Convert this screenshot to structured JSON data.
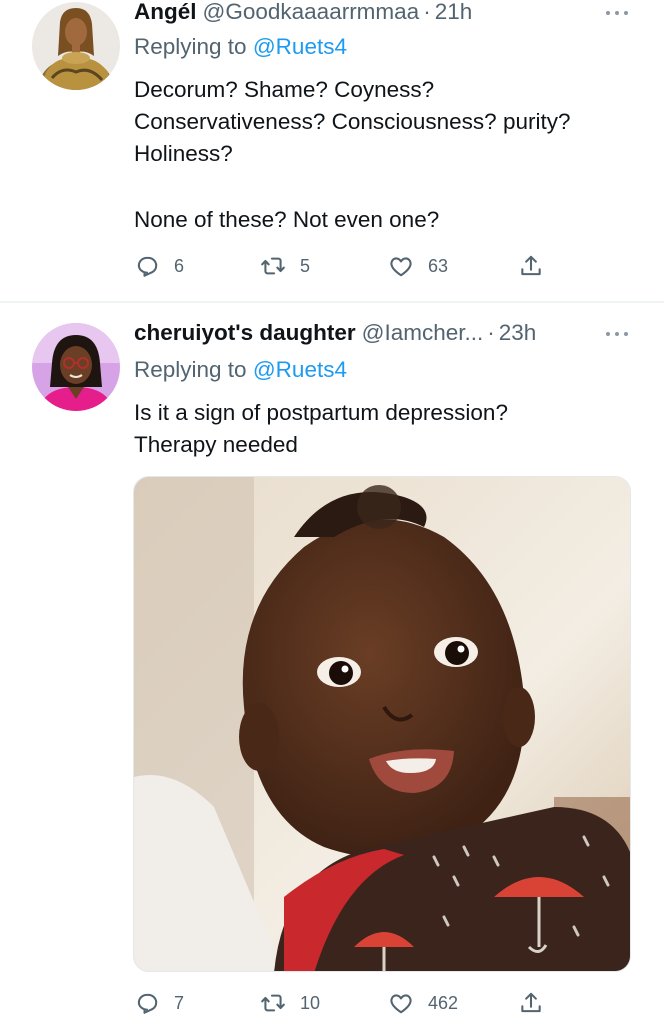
{
  "tweets": [
    {
      "display_name": "Angél",
      "handle": "@Goodkaaaarrmmaa",
      "separator": "·",
      "time": "21h",
      "replying_prefix": "Replying to",
      "replying_to": "@Ruets4",
      "lines": [
        "Decorum? Shame? Coyness?",
        "Conservativeness? Consciousness? purity?",
        "Holiness?",
        "None of these? Not even one?"
      ],
      "replies": "6",
      "retweets": "5",
      "likes": "63"
    },
    {
      "display_name": "cheruiyot's daughter",
      "handle": "@Iamcher...",
      "separator": "·",
      "time": "23h",
      "replying_prefix": "Replying to",
      "replying_to": "@Ruets4",
      "lines": [
        "Is it a sign of postpartum depression?",
        "Therapy needed"
      ],
      "media": "photo of a smiling baby in a dark onesie with red umbrella print",
      "replies": "7",
      "retweets": "10",
      "likes": "462"
    }
  ],
  "colors": {
    "link": "#1d9bf0",
    "secondary_text": "#536471",
    "primary_text": "#0f1419",
    "divider": "#eff3f4"
  },
  "icons": [
    "more-icon",
    "reply-icon",
    "retweet-icon",
    "like-icon",
    "share-icon"
  ]
}
